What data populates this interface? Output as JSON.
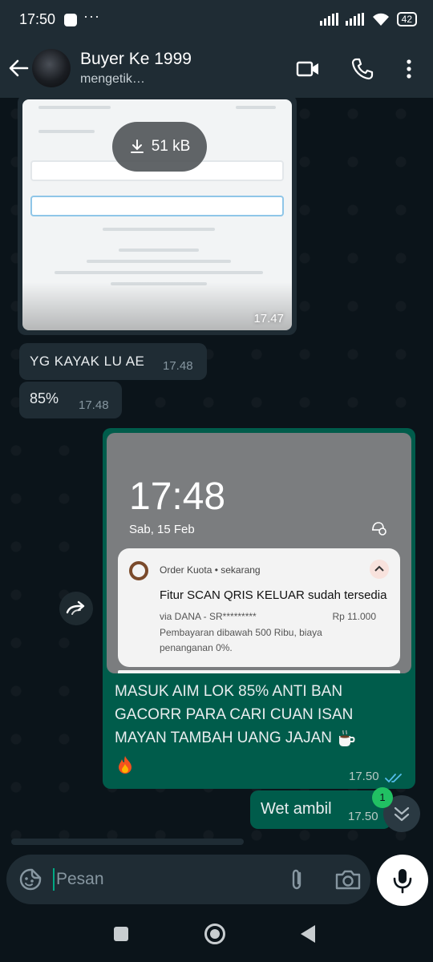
{
  "status_bar": {
    "time": "17:50",
    "more": "···",
    "battery": "42"
  },
  "header": {
    "name": "Buyer Ke 1999",
    "status": "mengetik…"
  },
  "messages": {
    "image": {
      "download_size": "51 kB",
      "time": "17.47"
    },
    "in1": {
      "text": "YG KAYAK LU AE",
      "time": "17.48"
    },
    "in2": {
      "text": "85%",
      "time": "17.48"
    },
    "screenshot": {
      "time_big": "17:48",
      "date": "Sab, 15 Feb",
      "notif_app": "Order Kuota • sekarang",
      "notif_title": "Fitur SCAN QRIS KELUAR sudah tersedia",
      "notif_sub": "via DANA - SR*********",
      "notif_amount": "Rp 11.000",
      "notif_body": "Pembayaran dibawah 500 Ribu, biaya penanganan 0%."
    },
    "caption": {
      "line1": "MASUK AIM LOK 85% ANTI BAN",
      "line2": "GACORR PARA CARI CUAN ISAN",
      "line3": "MAYAN TAMBAH UANG JAJAN",
      "time": "17.50"
    },
    "out2": {
      "text": "Wet ambil",
      "time": "17.50"
    }
  },
  "unread_badge": "1",
  "composer": {
    "placeholder": "Pesan"
  },
  "colors": {
    "accent": "#00a884",
    "outgoing_bubble": "#005c4b",
    "incoming_bubble": "#1f2c34",
    "read_ticks": "#53bdeb",
    "unread_badge": "#21c063"
  }
}
